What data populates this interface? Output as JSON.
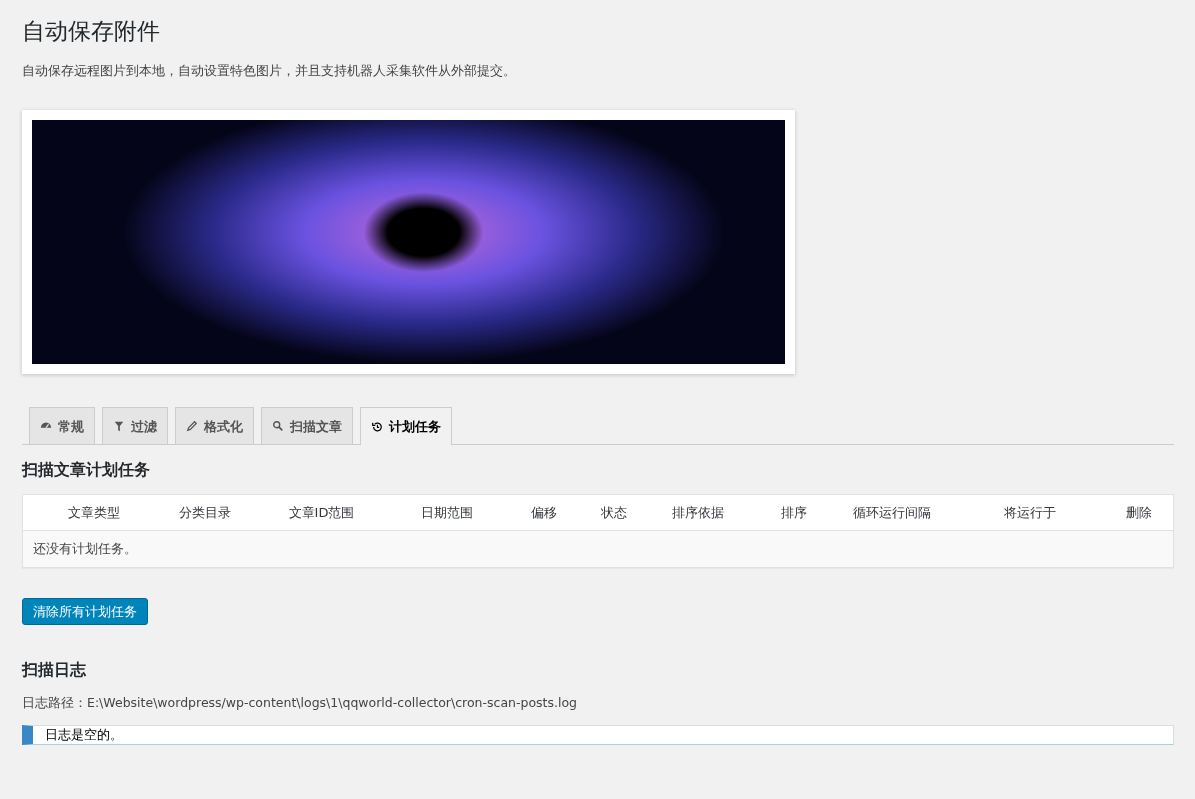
{
  "page": {
    "title": "自动保存附件",
    "description": "自动保存远程图片到本地，自动设置特色图片，并且支持机器人采集软件从外部提交。"
  },
  "tabs": [
    {
      "label": "常规",
      "selected": false
    },
    {
      "label": "过滤",
      "selected": false
    },
    {
      "label": "格式化",
      "selected": false
    },
    {
      "label": "扫描文章",
      "selected": false
    },
    {
      "label": "计划任务",
      "selected": true
    }
  ],
  "schedule": {
    "heading": "扫描文章计划任务",
    "table": {
      "columns": [
        "文章类型",
        "分类目录",
        "文章ID范围",
        "日期范围",
        "偏移",
        "状态",
        "排序依据",
        "排序",
        "循环运行间隔",
        "将运行于",
        "删除"
      ],
      "empty_message": "还没有计划任务。"
    },
    "clear_button": "清除所有计划任务"
  },
  "log": {
    "heading": "扫描日志",
    "path": "日志路径：E:\\Website\\wordpress/wp-content\\logs\\1\\qqworld-collector\\cron-scan-posts.log",
    "content": "日志是空的。"
  }
}
